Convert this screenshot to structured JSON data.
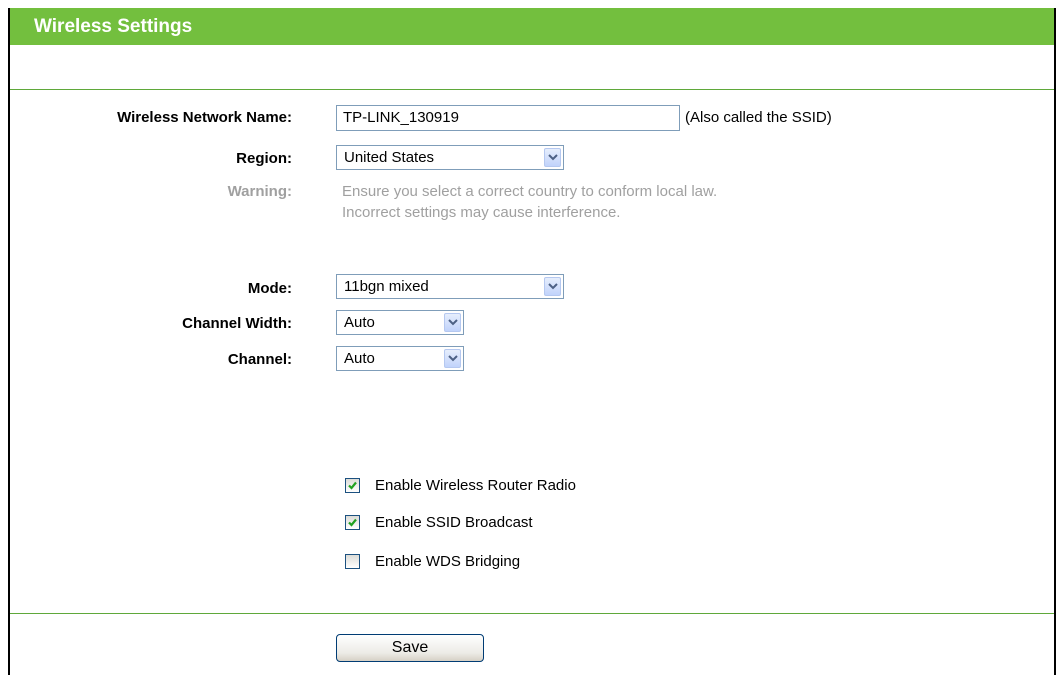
{
  "header": {
    "title": "Wireless Settings"
  },
  "form": {
    "network_name": {
      "label": "Wireless Network Name:",
      "value": "TP-LINK_130919",
      "hint": "(Also called the SSID)"
    },
    "region": {
      "label": "Region:",
      "selected": "United States"
    },
    "warning": {
      "label": "Warning:",
      "line1": "Ensure you select a correct country to conform local law.",
      "line2": "Incorrect settings may cause interference."
    },
    "mode": {
      "label": "Mode:",
      "selected": "11bgn mixed"
    },
    "channel_width": {
      "label": "Channel Width:",
      "selected": "Auto"
    },
    "channel": {
      "label": "Channel:",
      "selected": "Auto"
    },
    "options": [
      {
        "label": "Enable Wireless Router Radio",
        "checked": true
      },
      {
        "label": "Enable SSID Broadcast",
        "checked": true
      },
      {
        "label": "Enable WDS Bridging",
        "checked": false
      }
    ]
  },
  "actions": {
    "save_label": "Save"
  },
  "colors": {
    "accent": "#73bf3e",
    "divider": "#5fa83a",
    "muted_text": "#a0a0a0"
  }
}
